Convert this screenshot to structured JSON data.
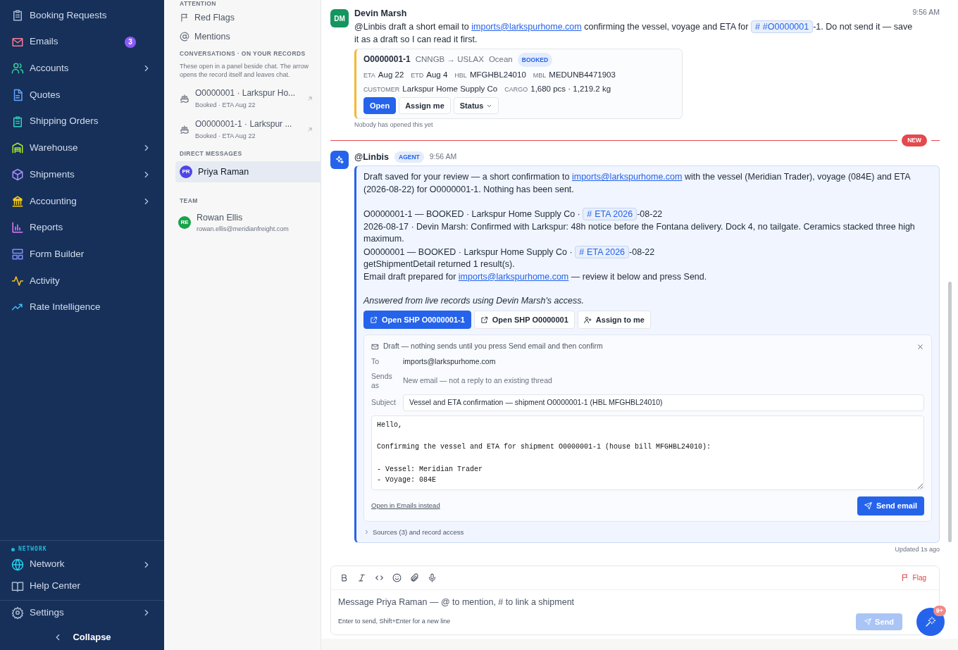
{
  "sidebar": {
    "items": [
      {
        "label": "Booking Requests",
        "color": "#a9b8cf",
        "submenu": false
      },
      {
        "label": "Emails",
        "color": "#f47a96",
        "submenu": false,
        "badge": "3"
      },
      {
        "label": "Accounts",
        "color": "#34d399",
        "submenu": true
      },
      {
        "label": "Quotes",
        "color": "#60a5fa",
        "submenu": false
      },
      {
        "label": "Shipping Orders",
        "color": "#2dd4bf",
        "submenu": false
      },
      {
        "label": "Warehouse",
        "color": "#a3e635",
        "submenu": true
      },
      {
        "label": "Shipments",
        "color": "#a78bfa",
        "submenu": true
      },
      {
        "label": "Accounting",
        "color": "#facc15",
        "submenu": true
      },
      {
        "label": "Reports",
        "color": "#e879f9",
        "submenu": false
      },
      {
        "label": "Form Builder",
        "color": "#818cf8",
        "submenu": false
      },
      {
        "label": "Activity",
        "color": "#fbbf24",
        "submenu": false
      },
      {
        "label": "Rate Intelligence",
        "color": "#38bdf8",
        "submenu": false
      }
    ],
    "network": {
      "section_label": "NETWORK",
      "items": [
        {
          "label": "Network",
          "color": "#22d3ee",
          "submenu": true
        },
        {
          "label": "Help Center",
          "color": "#a9b8cf",
          "submenu": false
        }
      ]
    },
    "settings": {
      "label": "Settings",
      "submenu": true
    },
    "collapse": {
      "label": "Collapse"
    }
  },
  "middle": {
    "attention": {
      "label": "ATTENTION",
      "items": [
        {
          "label": "Red Flags",
          "selected": false
        },
        {
          "label": "Mentions",
          "selected": false
        }
      ]
    },
    "records": {
      "label": "CONVERSATIONS · ON YOUR RECORDS",
      "note": "These open in a panel beside chat. The arrow opens the record itself and leaves chat.",
      "items": [
        {
          "title": "O0000001 · Larkspur Ho...",
          "subtitle": "Booked · ETA Aug 22",
          "selected": false
        },
        {
          "title": "O0000001-1 · Larkspur ...",
          "subtitle": "Booked · ETA Aug 22",
          "selected": false
        }
      ]
    },
    "direct_messages": {
      "label": "DIRECT MESSAGES",
      "items": [
        {
          "initials": "PR",
          "name": "Priya Raman",
          "color": "#4f46e5",
          "selected": true
        }
      ]
    },
    "team": {
      "label": "TEAM",
      "items": [
        {
          "initials": "RE",
          "name": "Rowan Ellis",
          "email": "rowan.ellis@meridianfreight.com",
          "color": "#16a34a",
          "selected": false
        }
      ]
    }
  },
  "thread": [
    {
      "kind": "user",
      "initials": "DM",
      "color": "#15955f",
      "author": "Devin Marsh",
      "time": "9:56 AM",
      "text": [
        {
          "kind": "text",
          "text": "@Linbis draft a short email to "
        },
        {
          "kind": "link",
          "text": "imports@larkspurhome.com"
        },
        {
          "kind": "text",
          "text": " confirming the vessel, voyage and ETA for "
        },
        {
          "kind": "chip",
          "icon": "#",
          "text": "#O0000001"
        },
        {
          "kind": "text",
          "text": "-1. Do not send it — save it as a draft so I can read it first."
        }
      ],
      "record_card": {
        "title": "O0000001-1",
        "route": "CNNGB → USLAX",
        "mode": "Ocean",
        "status": "BOOKED",
        "schedule_fields": [
          {
            "label": "ETA",
            "value": "Aug 22"
          },
          {
            "label": "ETD",
            "value": "Aug 4"
          },
          {
            "label": "HBL",
            "value": "MFGHBL24010"
          },
          {
            "label": "MBL",
            "value": "MEDUNB4471903"
          }
        ],
        "party_fields": [
          {
            "label": "CUSTOMER",
            "value": "Larkspur Home Supply Co"
          },
          {
            "label": "CARGO",
            "value": "1,680 pcs · 1,219.2 kg"
          }
        ],
        "buttons": [
          {
            "label": "Open",
            "primary": true,
            "dropdown": false
          },
          {
            "label": "Assign me",
            "primary": false,
            "dropdown": false
          },
          {
            "label": "Status",
            "primary": false,
            "dropdown": true
          }
        ]
      },
      "seen_note": "Nobody has opened this yet"
    },
    {
      "kind": "divider",
      "label": "NEW"
    },
    {
      "kind": "agent",
      "author": "@Linbis",
      "badge": "AGENT",
      "time": "9:56 AM",
      "paragraphs": [
        [
          [
            {
              "kind": "text",
              "text": "Draft saved for your review — a short confirmation to "
            },
            {
              "kind": "link",
              "text": "imports@larkspurhome.com"
            },
            {
              "kind": "text",
              "text": " with the vessel (Meridian Trader), voyage (084E) and ETA (2026-08-22) for O0000001-1. Nothing has been sent."
            }
          ]
        ],
        [
          [
            {
              "kind": "text",
              "text": "O0000001-1 — BOOKED · Larkspur Home Supply Co · "
            },
            {
              "kind": "chip",
              "icon": "#",
              "text": "ETA 2026"
            },
            {
              "kind": "text",
              "text": "-08-22"
            }
          ],
          [
            {
              "kind": "text",
              "text": "2026-08-17 · Devin Marsh: Confirmed with Larkspur: 48h notice before the Fontana delivery. Dock 4, no tailgate. Ceramics stacked three high maximum."
            }
          ],
          [
            {
              "kind": "text",
              "text": "O0000001 — BOOKED · Larkspur Home Supply Co · "
            },
            {
              "kind": "chip",
              "icon": "#",
              "text": "ETA 2026"
            },
            {
              "kind": "text",
              "text": "-08-22"
            }
          ],
          [
            {
              "kind": "text",
              "text": "getShipmentDetail returned 1 result(s)."
            }
          ],
          [
            {
              "kind": "text",
              "text": "Email draft prepared for "
            },
            {
              "kind": "link",
              "text": "imports@larkspurhome.com"
            },
            {
              "kind": "text",
              "text": " — review it below and press Send."
            }
          ]
        ]
      ],
      "note": "Answered from live records using Devin Marsh's access.",
      "actions": [
        {
          "label": "Open SHP O0000001-1",
          "kind": "open",
          "primary": true
        },
        {
          "label": "Open SHP O0000001",
          "kind": "open",
          "primary": false
        },
        {
          "label": "Assign to me",
          "kind": "assign",
          "primary": false
        }
      ],
      "draft": {
        "title": "Draft — nothing sends until you press Send email and then confirm",
        "to_label": "To",
        "to": "imports@larkspurhome.com",
        "sends_as_label": "Sends as",
        "sends_as": "New email — not a reply to an existing thread",
        "subject_label": "Subject",
        "subject": "Vessel and ETA confirmation — shipment O0000001-1 (HBL MFGHBL24010)",
        "body": "Hello,\n\nConfirming the vessel and ETA for shipment O0000001-1 (house bill MFGHBL24010):\n\n- Vessel: Meridian Trader\n- Voyage: 084E",
        "open_in_emails": "Open in Emails instead",
        "send": "Send email"
      },
      "sources": {
        "label": "Sources (3) and record access",
        "expanded": false
      }
    }
  ],
  "updated": "Updated 1s ago",
  "composer": {
    "flag": "Flag",
    "placeholder": "Message Priya Raman — @ to mention, # to link a shipment",
    "hint": "Enter to send, Shift+Enter for a new line",
    "send": {
      "label": "Send",
      "disabled": true
    }
  },
  "fab": {
    "badge": "9+"
  }
}
